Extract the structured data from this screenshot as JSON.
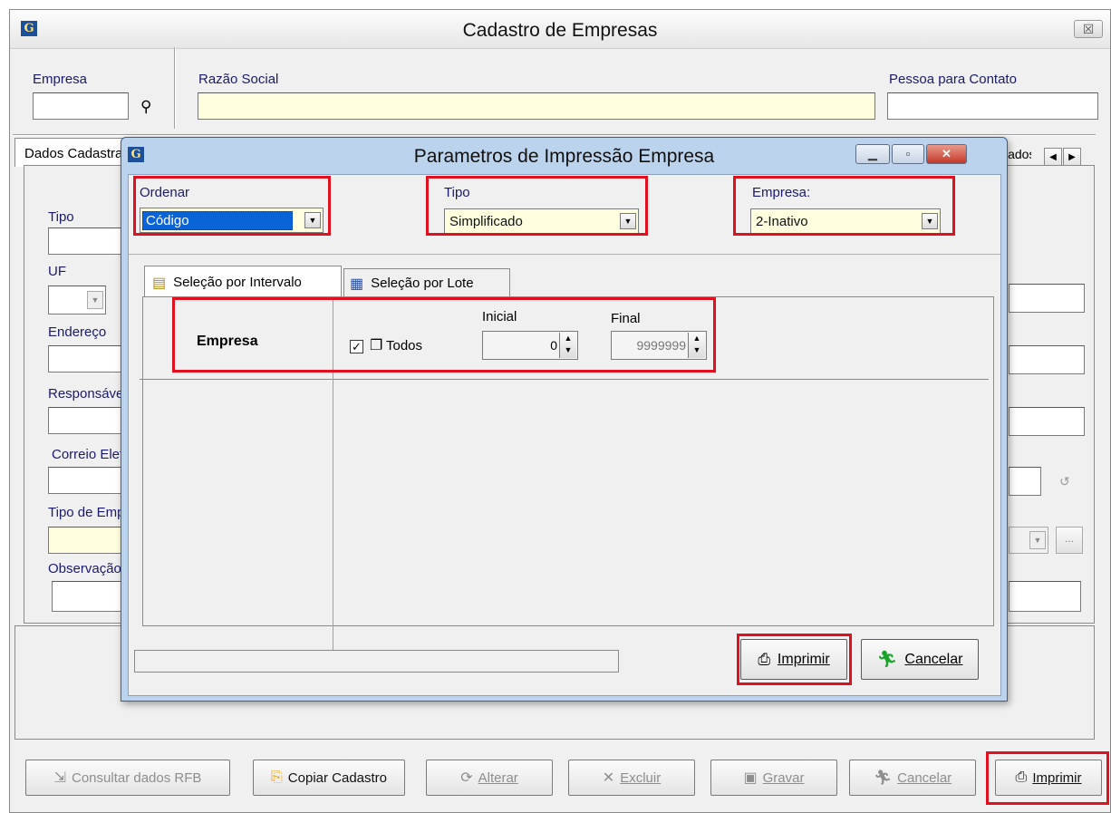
{
  "main_window": {
    "title": "Cadastro de Empresas",
    "close_glyph": "☒",
    "icon_letter": "G",
    "header": {
      "empresa_label": "Empresa",
      "razao_social_label": "Razão Social",
      "pessoa_contato_label": "Pessoa para Contato",
      "empresa_value": "",
      "razao_social_value": "",
      "pessoa_contato_value": ""
    },
    "tabs": [
      {
        "label": "Dados Cadastrais"
      },
      {
        "label": "Dados Co"
      }
    ],
    "form_labels": [
      "Tipo",
      "UF",
      "Endereço",
      "Responsável",
      "Correio Eletrônico",
      "Tipo de Empresa",
      "Observação"
    ],
    "buttons": [
      {
        "label": "Consultar dados RFB",
        "icon": "download-doc-icon",
        "enabled": false
      },
      {
        "label": "Copiar Cadastro",
        "icon": "copy-icon",
        "enabled": true
      },
      {
        "label": "Alterar",
        "icon": "refresh-icon",
        "enabled": false
      },
      {
        "label": "Excluir",
        "icon": "delete-icon",
        "enabled": false
      },
      {
        "label": "Gravar",
        "icon": "save-icon",
        "enabled": false
      },
      {
        "label": "Cancelar",
        "icon": "running-man-icon",
        "enabled": false
      },
      {
        "label": "Imprimir",
        "icon": "printer-icon",
        "enabled": true
      }
    ],
    "ellipsis_label": "..."
  },
  "dialog": {
    "title": "Parametros de Impressão Empresa",
    "ordenar": {
      "label": "Ordenar",
      "value": "Código"
    },
    "tipo": {
      "label": "Tipo",
      "value": "Simplificado"
    },
    "empresa": {
      "label": "Empresa:",
      "value": "2-Inativo"
    },
    "tabs": [
      {
        "label": "Seleção por Intervalo",
        "icon": "document-list-icon"
      },
      {
        "label": "Seleção por Lote",
        "icon": "grid-icon"
      }
    ],
    "range": {
      "row_label": "Empresa",
      "todos_label": "Todos",
      "todos_checked": true,
      "inicial_label": "Inicial",
      "inicial_value": "0",
      "final_label": "Final",
      "final_value": "9999999"
    },
    "buttons": {
      "imprimir": "Imprimir",
      "cancelar": "Cancelar"
    }
  },
  "colors": {
    "highlight_red": "#e0101f",
    "field_yellow": "#ffffe0",
    "selection_blue": "#0a64d8",
    "dialog_frame": "#bcd3ee"
  }
}
